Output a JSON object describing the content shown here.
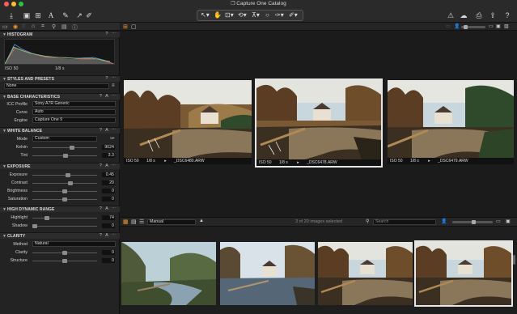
{
  "window": {
    "title": "Capture One Catalog",
    "traffic_lights": [
      "#fe5f57",
      "#febc2e",
      "#28c840"
    ]
  },
  "toolbar": {
    "left_icons": [
      "import-icon",
      "capture-icon",
      "export-icon",
      "text-icon",
      "pen-icon",
      "arrow-icon",
      "brush-icon"
    ],
    "center_tools": [
      "cursor-icon",
      "hand-icon",
      "crop-icon",
      "rotate-icon",
      "circle-icon",
      "picker-icon",
      "brush-icon"
    ],
    "right_icons": [
      "warning-icon",
      "cloud-icon",
      "print-icon",
      "share-icon",
      "help-icon"
    ]
  },
  "panel": {
    "histogram": {
      "title": "HISTOGRAM",
      "iso": "ISO 50",
      "shutter": "1/8 s"
    },
    "styles": {
      "title": "STYLES AND PRESETS",
      "value": "None"
    },
    "base": {
      "title": "BASE CHARACTERISTICS",
      "icc_label": "ICC Profile",
      "icc_value": "Sony A7R Generic",
      "curve_label": "Curve",
      "curve_value": "Auto",
      "engine_label": "Engine",
      "engine_value": "Capture One 9"
    },
    "white_balance": {
      "title": "WHITE BALANCE",
      "mode_label": "Mode",
      "mode_value": "Custom",
      "kelvin_label": "Kelvin",
      "kelvin_value": "9024",
      "kelvin_level": 0.62,
      "tint_label": "Tint",
      "tint_value": "3.3",
      "tint_level": 0.52
    },
    "exposure": {
      "title": "EXPOSURE",
      "exposure_label": "Exposure",
      "exposure_value": "0.45",
      "exposure_level": 0.55,
      "contrast_label": "Contrast",
      "contrast_value": "20",
      "contrast_level": 0.6,
      "brightness_label": "Brightness",
      "brightness_value": "0",
      "brightness_level": 0.5,
      "saturation_label": "Saturation",
      "saturation_value": "0",
      "saturation_level": 0.5
    },
    "hdr": {
      "title": "HIGH DYNAMIC RANGE",
      "highlight_label": "Highlight",
      "highlight_value": "74",
      "highlight_level": 0.2,
      "shadow_label": "Shadow",
      "shadow_value": "0",
      "shadow_level": 0.0
    },
    "clarity": {
      "title": "CLARITY",
      "method_label": "Method",
      "method_value": "Natural",
      "clarity_label": "Clarity",
      "clarity_value": "0",
      "clarity_level": 0.5,
      "structure_label": "Structure",
      "structure_value": "0",
      "structure_level": 0.5
    }
  },
  "viewer": {
    "photos": [
      {
        "iso": "ISO 50",
        "shutter": "1/8 s",
        "name": "_DSC6480.ARW"
      },
      {
        "iso": "ISO 50",
        "shutter": "1/8 s",
        "name": "_DSC6478.ARW"
      },
      {
        "iso": "ISO 50",
        "shutter": "1/8 s",
        "name": "_DSC6479.ARW"
      }
    ]
  },
  "browser": {
    "sort_value": "Manual",
    "count_text": "3 of 20 images selected",
    "search_placeholder": "Search"
  }
}
